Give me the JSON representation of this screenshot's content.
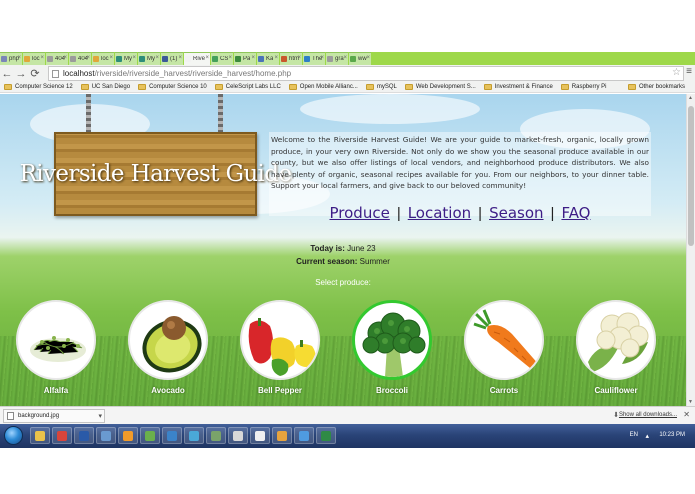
{
  "browser": {
    "tabs": [
      {
        "title": "php",
        "favicon_color": "#7a86b8"
      },
      {
        "title": "loc",
        "favicon_color": "#e0a73a"
      },
      {
        "title": "404",
        "favicon_color": "#9b9b9b"
      },
      {
        "title": "404",
        "favicon_color": "#9b9b9b"
      },
      {
        "title": "loc",
        "favicon_color": "#e0a73a"
      },
      {
        "title": "My",
        "favicon_color": "#2d8d7a"
      },
      {
        "title": "My",
        "favicon_color": "#2d8d7a"
      },
      {
        "title": "(1)",
        "favicon_color": "#3b5998"
      },
      {
        "title": "Rive",
        "favicon_color": "#f2f2f2"
      },
      {
        "title": "CS",
        "favicon_color": "#44a05a"
      },
      {
        "title": "Pa",
        "favicon_color": "#3c8a3c"
      },
      {
        "title": "Ka",
        "favicon_color": "#4a73b8"
      },
      {
        "title": "htm",
        "favicon_color": "#c9572b"
      },
      {
        "title": "The",
        "favicon_color": "#2e7fc6"
      },
      {
        "title": "gra",
        "favicon_color": "#9b9b9b"
      },
      {
        "title": "ww",
        "favicon_color": "#5aa84a"
      }
    ],
    "active_tab_index": 8,
    "url_host": "localhost",
    "url_path": "/riverside/riverside_harvest/riverside_harvest/home.php",
    "bookmarks": [
      "Computer Science 12",
      "UC San Diego",
      "Computer Science 10",
      "CeleScript Labs LLC",
      "Open Mobile Allianc...",
      "mySQL",
      "Web Development S...",
      "Investment & Finance",
      "Raspberry Pi"
    ],
    "other_bookmarks": "Other bookmarks"
  },
  "site": {
    "sign_title": "Riverside Harvest Guide",
    "intro": "Welcome to the Riverside Harvest Guide! We are your guide to market-fresh, organic, locally grown produce, in your very own Riverside. Not only do we show you the seasonal produce available in our county, but we also offer listings of local vendors, and neighborhood produce distributors. We also have plenty of organic, seasonal recipes available for you. From our neighbors, to your dinner table. Support your local farmers, and give back to our beloved community!",
    "nav": [
      "Produce",
      "Location",
      "Season",
      "FAQ"
    ],
    "today_label": "Today is:",
    "today_value": "June 23",
    "season_label": "Current season:",
    "season_value": "Summer",
    "select_prompt": "Select produce:",
    "produce": [
      {
        "name": "Alfalfa",
        "selected": false
      },
      {
        "name": "Avocado",
        "selected": false
      },
      {
        "name": "Bell Pepper",
        "selected": false
      },
      {
        "name": "Broccoli",
        "selected": true
      },
      {
        "name": "Carrots",
        "selected": false
      },
      {
        "name": "Cauliflower",
        "selected": false
      }
    ]
  },
  "downloads": {
    "file": "background.jpg",
    "show_all": "Show all downloads..."
  },
  "taskbar": {
    "lang": "EN",
    "time": "10:23 PM",
    "apps": [
      {
        "name": "explorer",
        "color": "#e9c24a"
      },
      {
        "name": "chrome",
        "color": "#d8453b"
      },
      {
        "name": "photoshop",
        "color": "#2a5aa8"
      },
      {
        "name": "windows",
        "color": "#6a9ad0"
      },
      {
        "name": "media",
        "color": "#f29b2a"
      },
      {
        "name": "folder-green",
        "color": "#6ab04c"
      },
      {
        "name": "photos",
        "color": "#3b83c9"
      },
      {
        "name": "browser",
        "color": "#4aa8d8"
      },
      {
        "name": "tool",
        "color": "#7aa36a"
      },
      {
        "name": "terminal",
        "color": "#d8d8d8"
      },
      {
        "name": "notepad",
        "color": "#f0f0f0"
      },
      {
        "name": "paint",
        "color": "#e6a33e"
      },
      {
        "name": "network",
        "color": "#4f9be0"
      },
      {
        "name": "excel",
        "color": "#2f8a46"
      }
    ]
  }
}
